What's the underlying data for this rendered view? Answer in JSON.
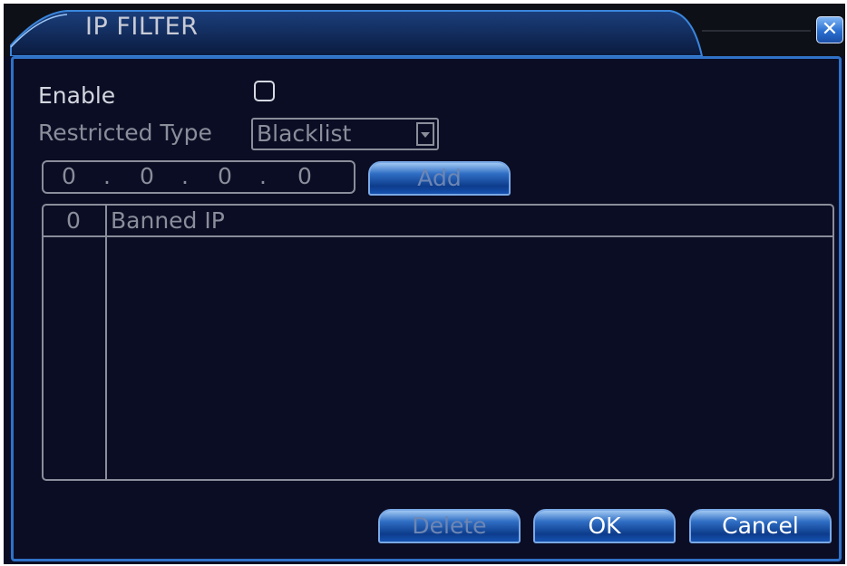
{
  "window": {
    "title": "IP FILTER",
    "close_icon": "close-icon",
    "close_glyph": "✕"
  },
  "form": {
    "enable_label": "Enable",
    "enable_checked": false,
    "restricted_type_label": "Restricted Type",
    "restricted_type_value": "Blacklist",
    "ip_parts": [
      "0",
      "0",
      "0",
      "0"
    ],
    "ip_separator": ".",
    "add_button": "Add"
  },
  "table": {
    "columns": [
      "0",
      "Banned IP"
    ],
    "rows": []
  },
  "footer": {
    "delete_button": "Delete",
    "ok_button": "OK",
    "cancel_button": "Cancel"
  },
  "colors": {
    "background": "#0b0d24",
    "frame": "#2f72c8",
    "text": "#d3d6df",
    "disabled_text": "#8a8d9a"
  }
}
